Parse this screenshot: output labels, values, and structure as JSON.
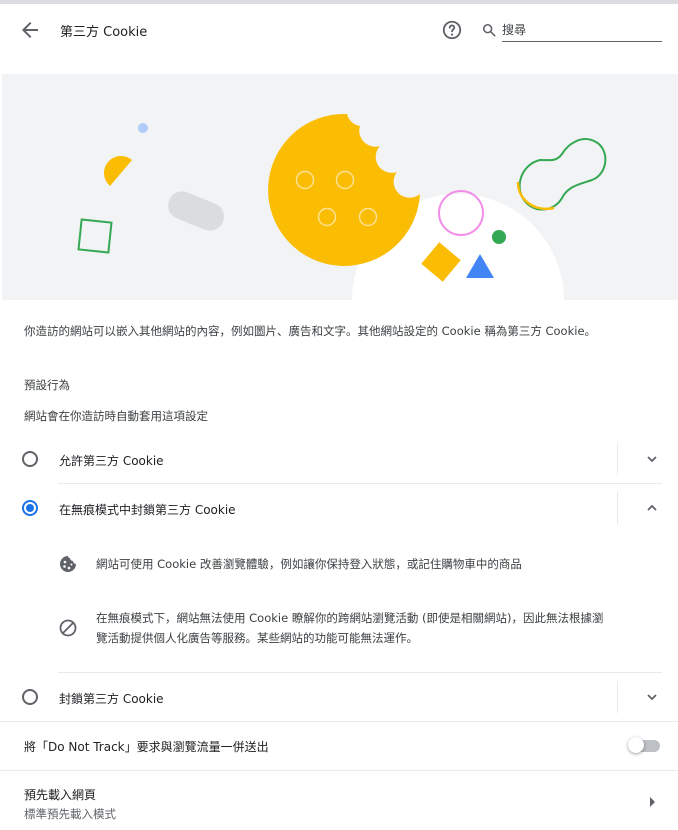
{
  "header": {
    "title": "第三方 Cookie",
    "back_icon": "arrow-left-icon",
    "help_icon": "help-circle-icon",
    "search": {
      "placeholder": "搜尋",
      "value": "",
      "icon": "search-icon"
    }
  },
  "intro": {
    "description": "你造訪的網站可以嵌入其他網站的內容，例如圖片、廣告和文字。其他網站設定的 Cookie 稱為第三方 Cookie。"
  },
  "default_behavior": {
    "title": "預設行為",
    "subtitle": "網站會在你造訪時自動套用這項設定",
    "options": [
      {
        "label": "允許第三方 Cookie",
        "selected": false,
        "expanded": false
      },
      {
        "label": "在無痕模式中封鎖第三方 Cookie",
        "selected": true,
        "expanded": true
      },
      {
        "label": "封鎖第三方 Cookie",
        "selected": false,
        "expanded": false
      }
    ],
    "expanded_details": [
      {
        "icon": "cookie-icon",
        "text": "網站可使用 Cookie 改善瀏覽體驗，例如讓你保持登入狀態，或記住購物車中的商品"
      },
      {
        "icon": "block-icon",
        "line1": "在無痕模式下，網站無法使用 Cookie 瞭解你的跨網站瀏覽活動 (即使是相關網站)，因此無法根據瀏",
        "line2": "覽活動提供個人化廣告等服務。某些網站的功能可能無法運作。"
      }
    ]
  },
  "do_not_track": {
    "label": "將「Do Not Track」要求與瀏覽流量一併送出",
    "enabled": false
  },
  "preload": {
    "title": "預先載入網頁",
    "subtitle": "標準預先載入模式"
  },
  "colors": {
    "accent": "#1a73e8",
    "yellow": "#fbbc04",
    "green": "#34a853",
    "pink": "#f28ee8"
  }
}
